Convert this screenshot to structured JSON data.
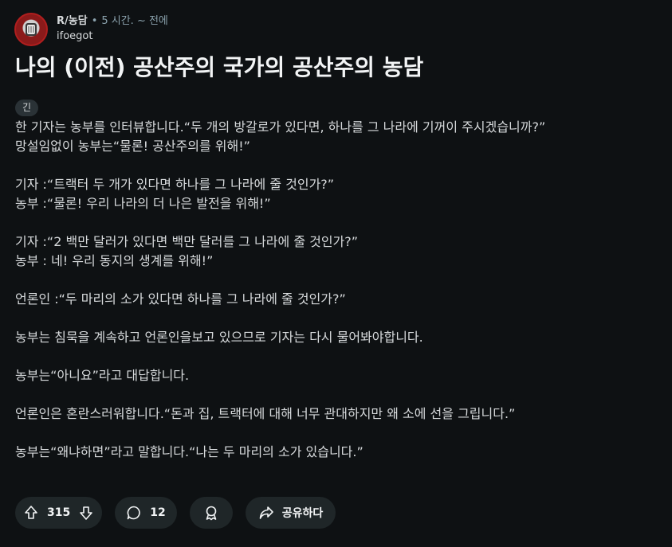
{
  "post": {
    "subreddit": "R/농담",
    "time": "5 시간. ~ 전에",
    "author": "ifoegot",
    "title": "나의 (이전) 공산주의 국가의 공산주의 농담",
    "flair": "긴",
    "paragraphs": [
      [
        "한 기자는 농부를 인터뷰합니다.“두 개의 방갈로가 있다면, 하나를 그 나라에 기꺼이 주시겠습니까?”",
        "망설임없이 농부는“물론! 공산주의를 위해!”"
      ],
      [
        "기자 :“트랙터 두 개가 있다면 하나를 그 나라에 줄 것인가?”",
        "농부 :“물론! 우리 나라의 더 나은 발전을 위해!”"
      ],
      [
        "기자 :“2 백만 달러가 있다면 백만 달러를 그 나라에 줄 것인가?”",
        "농부 : 네! 우리 동지의 생계를 위해!”"
      ],
      [
        "언론인 :“두 마리의 소가 있다면 하나를 그 나라에 줄 것인가?”"
      ],
      [
        "농부는 침묵을 계속하고 언론인을보고 있으므로 기자는 다시 물어봐야합니다."
      ],
      [
        "농부는“아니요”라고 대답합니다."
      ],
      [
        "언론인은 혼란스러워합니다.“돈과 집, 트랙터에 대해 너무 관대하지만 왜 소에 선을 그립니다.”"
      ],
      [
        "농부는“왜냐하면”라고 말합니다.“나는 두 마리의 소가 있습니다.”"
      ]
    ]
  },
  "actions": {
    "vote_count": "315",
    "comment_count": "12",
    "share_label": "공유하다"
  },
  "icons": {
    "avatar": "subreddit-avatar-icon",
    "upvote": "arrow-up-icon",
    "downvote": "arrow-down-icon",
    "comment": "comment-bubble-icon",
    "award": "award-icon",
    "share": "share-arrow-icon"
  },
  "colors": {
    "background": "#0e1113",
    "pill": "#1f2628",
    "text": "#d7dadc",
    "meta": "#8ba2ad",
    "avatar_red": "#b01e1e"
  }
}
